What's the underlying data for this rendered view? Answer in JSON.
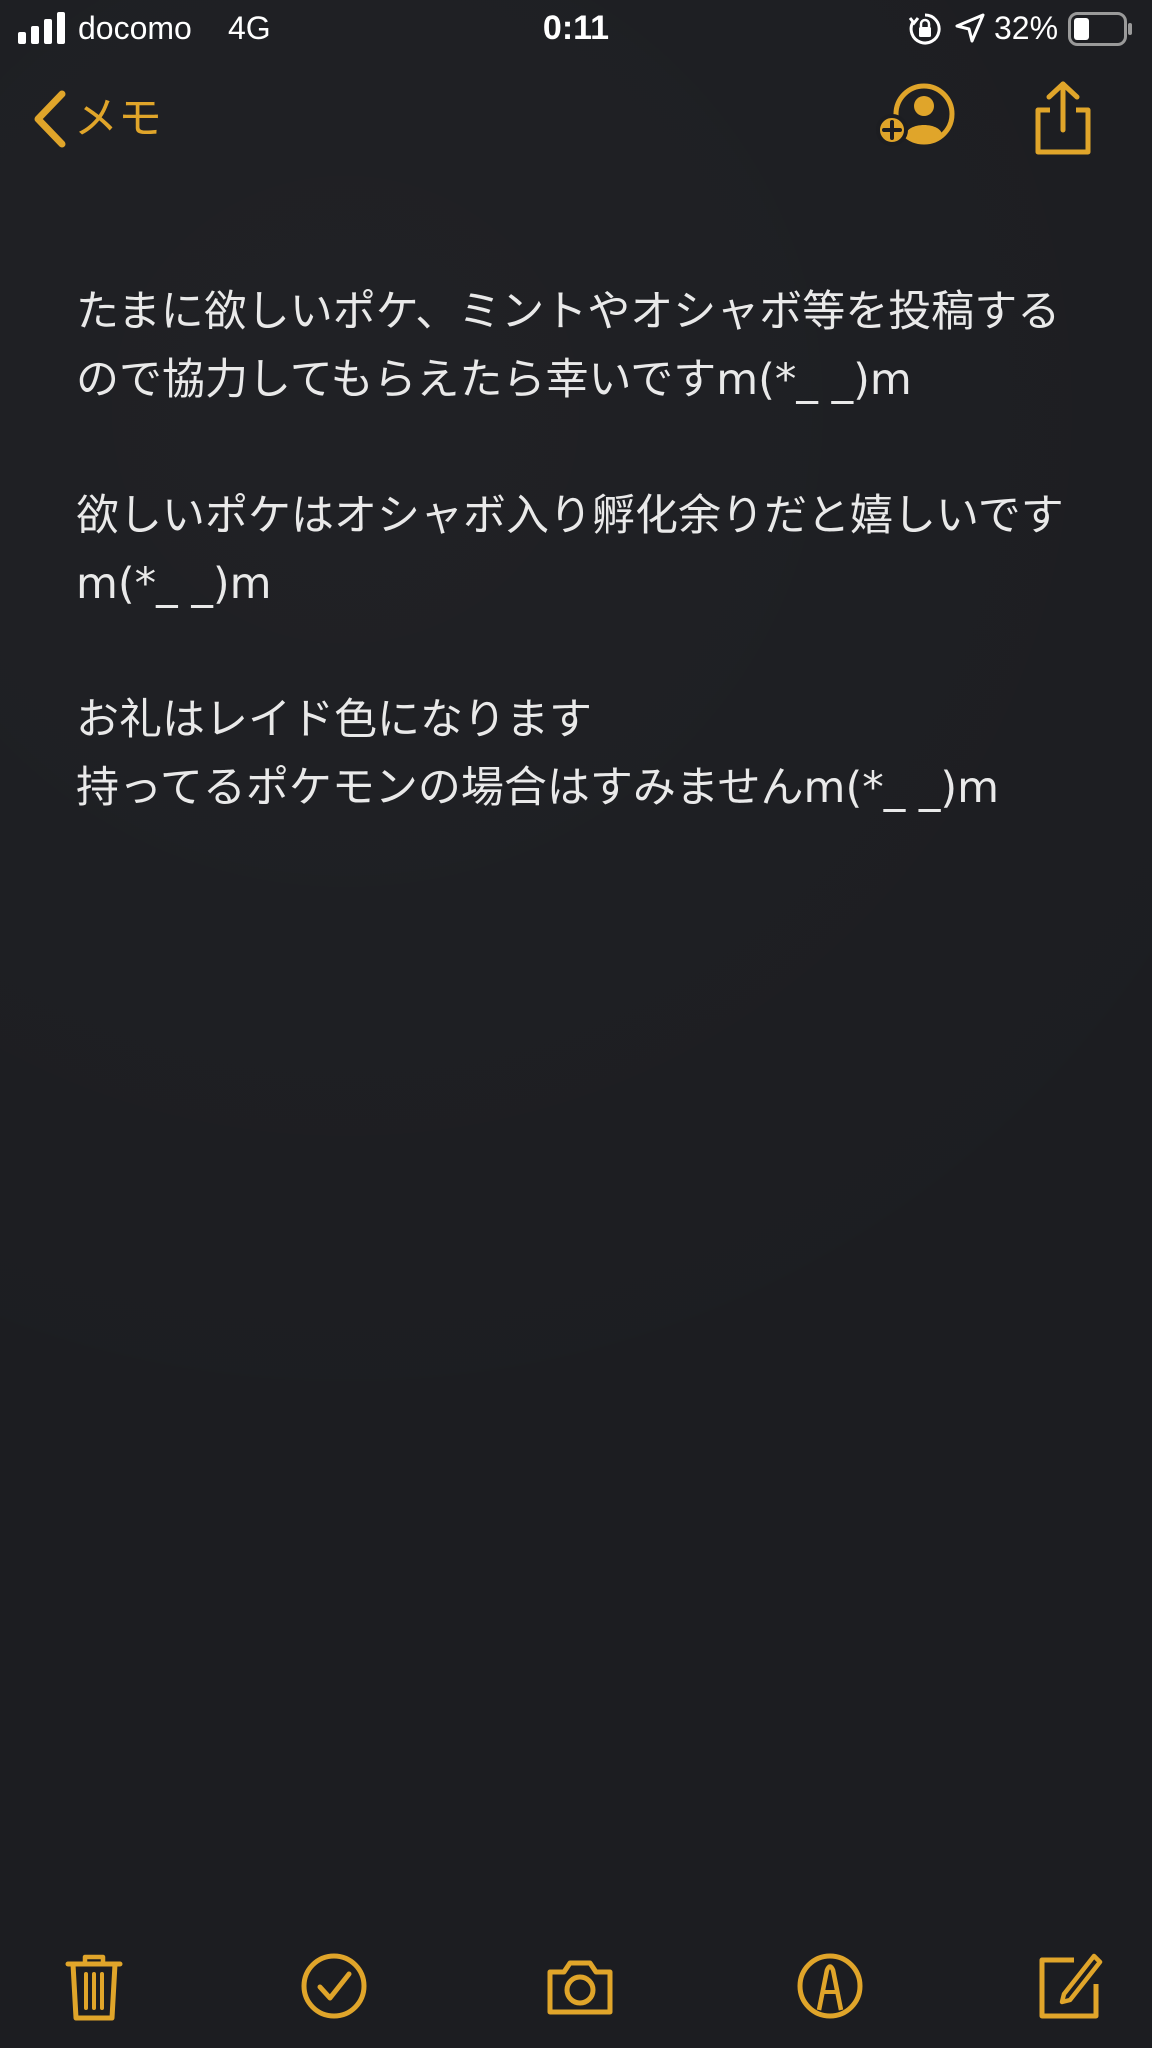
{
  "status_bar": {
    "carrier": "docomo",
    "network": "4G",
    "time": "0:11",
    "battery_percent": "32%",
    "signal_bars": 4,
    "battery_level": 0.32,
    "icons": [
      "signal-icon",
      "orientation-lock-icon",
      "location-arrow-icon",
      "battery-icon"
    ]
  },
  "nav": {
    "back_label": "メモ",
    "back_icon": "chevron-left-icon",
    "add_person_icon": "add-person-icon",
    "share_icon": "share-icon"
  },
  "note": {
    "paragraphs": [
      "たまに欲しいポケ、ミントやオシャボ等を投稿するので協力してもらえたら幸いですm(*_ _)m",
      "欲しいポケはオシャボ入り孵化余りだと嬉しいですm(*_ _)m",
      "お礼はレイド色になります\n持ってるポケモンの場合はすみませんm(*_ _)m"
    ]
  },
  "toolbar": {
    "icons": [
      "trash-icon",
      "checklist-icon",
      "camera-icon",
      "markup-icon",
      "compose-icon"
    ]
  },
  "colors": {
    "accent": "#e0a52a",
    "background": "#1c1d21",
    "text": "#e9e9e9",
    "status_text": "#ffffff"
  }
}
